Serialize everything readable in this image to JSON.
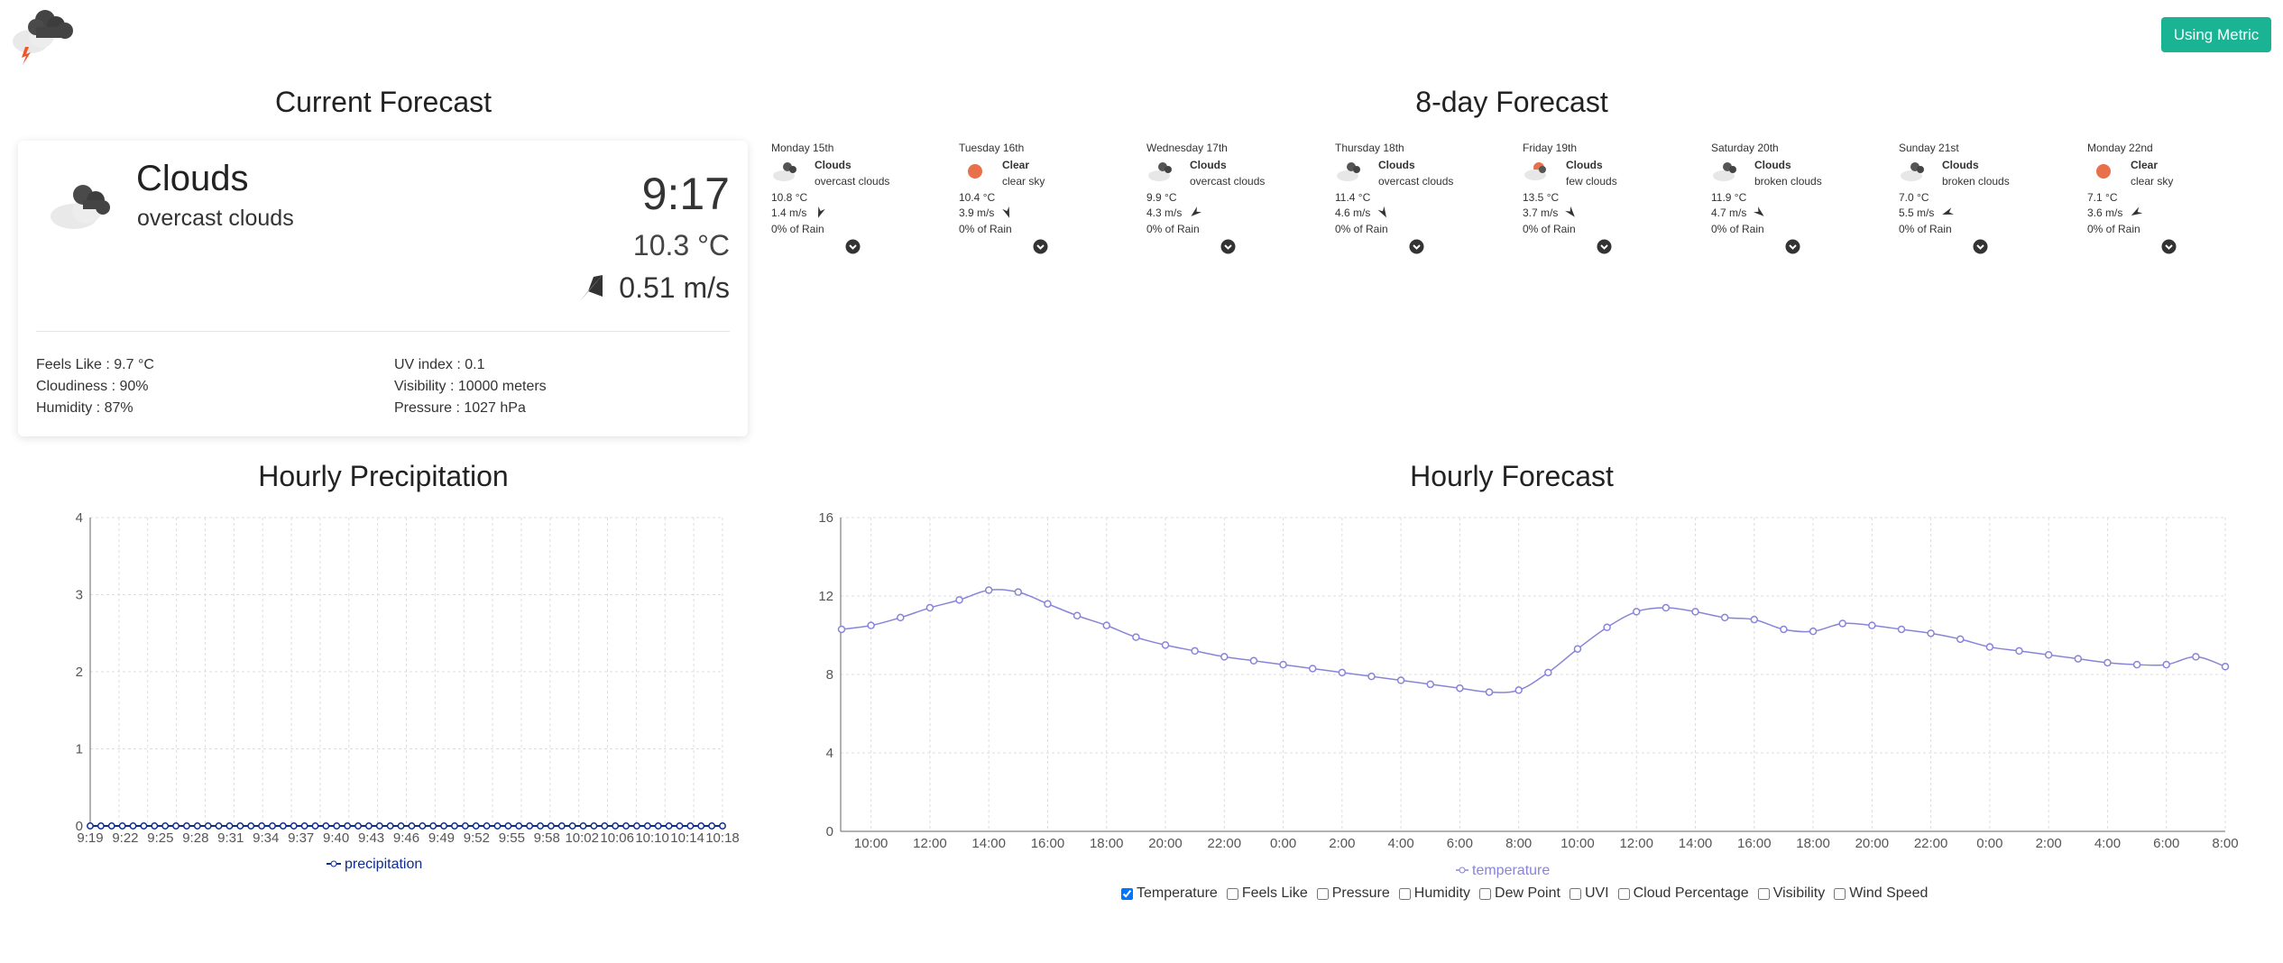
{
  "header": {
    "logo_icon": "storm-cloud-icon",
    "unit_button": "Using Metric"
  },
  "titles": {
    "current": "Current Forecast",
    "eight_day": "8-day Forecast",
    "precip": "Hourly Precipitation",
    "hourly": "Hourly Forecast"
  },
  "current": {
    "icon": "overcast-clouds-icon",
    "condition": "Clouds",
    "description": "overcast clouds",
    "time": "9:17",
    "temp": "10.3 °C",
    "wind": "0.51 m/s",
    "wind_icon": "wind-direction-arrow-icon",
    "details": {
      "feels_like": "Feels Like : 9.7 °C",
      "cloudiness": "Cloudiness : 90%",
      "humidity": "Humidity : 87%",
      "uv": "UV index : 0.1",
      "visibility": "Visibility : 10000 meters",
      "pressure": "Pressure : 1027 hPa"
    }
  },
  "days": [
    {
      "name": "Monday 15th",
      "icon": "clouds-icon",
      "main": "Clouds",
      "desc": "overcast clouds",
      "temp": "10.8 °C",
      "wind": "1.4 m/s",
      "rain": "0% of Rain"
    },
    {
      "name": "Tuesday 16th",
      "icon": "sun-icon",
      "main": "Clear",
      "desc": "clear sky",
      "temp": "10.4 °C",
      "wind": "3.9 m/s",
      "rain": "0% of Rain"
    },
    {
      "name": "Wednesday 17th",
      "icon": "clouds-icon",
      "main": "Clouds",
      "desc": "overcast clouds",
      "temp": "9.9 °C",
      "wind": "4.3 m/s",
      "rain": "0% of Rain"
    },
    {
      "name": "Thursday 18th",
      "icon": "clouds-icon",
      "main": "Clouds",
      "desc": "overcast clouds",
      "temp": "11.4 °C",
      "wind": "4.6 m/s",
      "rain": "0% of Rain"
    },
    {
      "name": "Friday 19th",
      "icon": "few-clouds-icon",
      "main": "Clouds",
      "desc": "few clouds",
      "temp": "13.5 °C",
      "wind": "3.7 m/s",
      "rain": "0% of Rain"
    },
    {
      "name": "Saturday 20th",
      "icon": "clouds-icon",
      "main": "Clouds",
      "desc": "broken clouds",
      "temp": "11.9 °C",
      "wind": "4.7 m/s",
      "rain": "0% of Rain"
    },
    {
      "name": "Sunday 21st",
      "icon": "clouds-icon",
      "main": "Clouds",
      "desc": "broken clouds",
      "temp": "7.0 °C",
      "wind": "5.5 m/s",
      "rain": "0% of Rain"
    },
    {
      "name": "Monday 22nd",
      "icon": "sun-icon",
      "main": "Clear",
      "desc": "clear sky",
      "temp": "7.1 °C",
      "wind": "3.6 m/s",
      "rain": "0% of Rain"
    }
  ],
  "checkboxes": [
    {
      "label": "Temperature",
      "checked": true
    },
    {
      "label": "Feels Like",
      "checked": false
    },
    {
      "label": "Pressure",
      "checked": false
    },
    {
      "label": "Humidity",
      "checked": false
    },
    {
      "label": "Dew Point",
      "checked": false
    },
    {
      "label": "UVI",
      "checked": false
    },
    {
      "label": "Cloud Percentage",
      "checked": false
    },
    {
      "label": "Visibility",
      "checked": false
    },
    {
      "label": "Wind Speed",
      "checked": false
    }
  ],
  "colors": {
    "accent": "#1ab394",
    "series": "#8884d8",
    "precip": "#0f2d8a",
    "sun": "#e8704a"
  },
  "chart_data": [
    {
      "type": "line",
      "title": "Hourly Precipitation",
      "legend": "precipitation",
      "ylim": [
        0,
        4
      ],
      "yticks": [
        0,
        1,
        2,
        3,
        4
      ],
      "x_labels": [
        "9:19",
        "9:22",
        "9:25",
        "9:28",
        "9:31",
        "9:34",
        "9:37",
        "9:40",
        "9:43",
        "9:46",
        "9:49",
        "9:52",
        "9:55",
        "9:58",
        "10:02",
        "10:06",
        "10:10",
        "10:14",
        "10:18"
      ],
      "points": 60,
      "values_all": 0
    },
    {
      "type": "line",
      "title": "Hourly Forecast",
      "legend": "temperature",
      "ylim": [
        0,
        16
      ],
      "yticks": [
        0,
        4,
        8,
        12,
        16
      ],
      "x_labels": [
        "10:00",
        "12:00",
        "14:00",
        "16:00",
        "18:00",
        "20:00",
        "22:00",
        "0:00",
        "2:00",
        "4:00",
        "6:00",
        "8:00",
        "10:00",
        "12:00",
        "14:00",
        "16:00",
        "18:00",
        "20:00",
        "22:00",
        "0:00",
        "2:00",
        "4:00",
        "6:00",
        "8:00"
      ],
      "values": [
        10.3,
        10.5,
        10.9,
        11.4,
        11.8,
        12.3,
        12.2,
        11.6,
        11.0,
        10.5,
        9.9,
        9.5,
        9.2,
        8.9,
        8.7,
        8.5,
        8.3,
        8.1,
        7.9,
        7.7,
        7.5,
        7.3,
        7.1,
        7.2,
        8.1,
        9.3,
        10.4,
        11.2,
        11.4,
        11.2,
        10.9,
        10.8,
        10.3,
        10.2,
        10.6,
        10.5,
        10.3,
        10.1,
        9.8,
        9.4,
        9.2,
        9.0,
        8.8,
        8.6,
        8.5,
        8.5,
        8.9,
        8.4
      ]
    }
  ]
}
